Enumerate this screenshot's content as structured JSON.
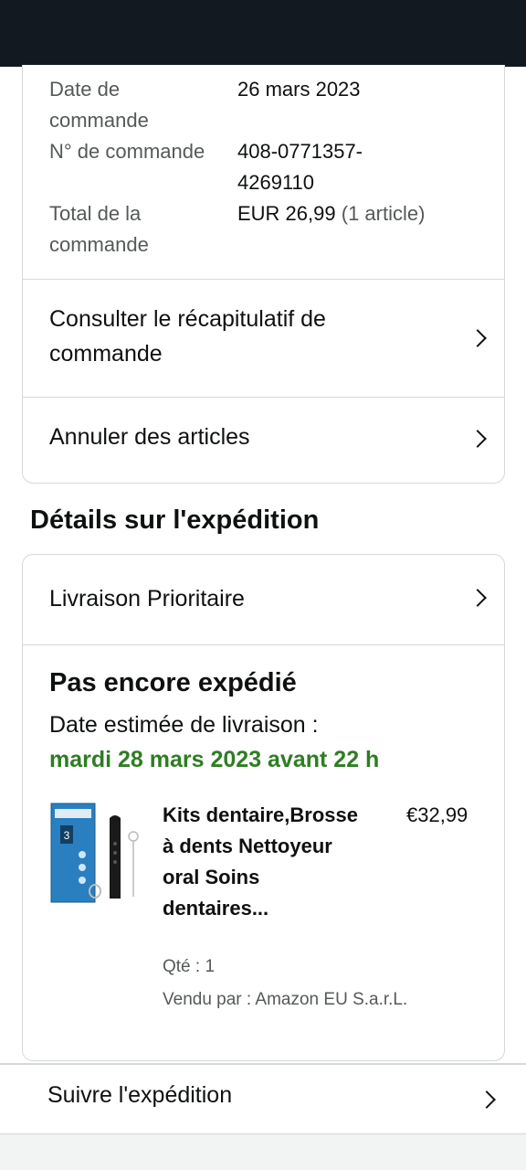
{
  "order_info": {
    "date_label": "Date de commande",
    "date_value": "26 mars 2023",
    "number_label": "N° de commande",
    "number_value": "408-0771357-4269110",
    "total_label": "Total de la commande",
    "total_value": "EUR 26,99",
    "total_items": "(1 article)"
  },
  "order_actions": {
    "summary_label": "Consulter le récapitulatif de commande",
    "cancel_label": "Annuler des articles"
  },
  "shipping": {
    "section_title": "Détails sur l'expédition",
    "delivery_option": "Livraison Prioritaire",
    "status": "Pas encore expédié",
    "eta_label": "Date estimée de livraison :",
    "eta_date": "mardi 28 mars 2023 avant 22 h",
    "colors": {
      "eta": "#2e7d22"
    }
  },
  "product": {
    "title": "Kits dentaire,Brosse à dents Nettoyeur oral Soins dentaires...",
    "price": "€32,99",
    "quantity": "Qté : 1",
    "seller": "Vendu par : Amazon EU S.a.r.L.",
    "image_icon": "dental-kit-product-image"
  },
  "track": {
    "label": "Suivre l'expédition"
  }
}
